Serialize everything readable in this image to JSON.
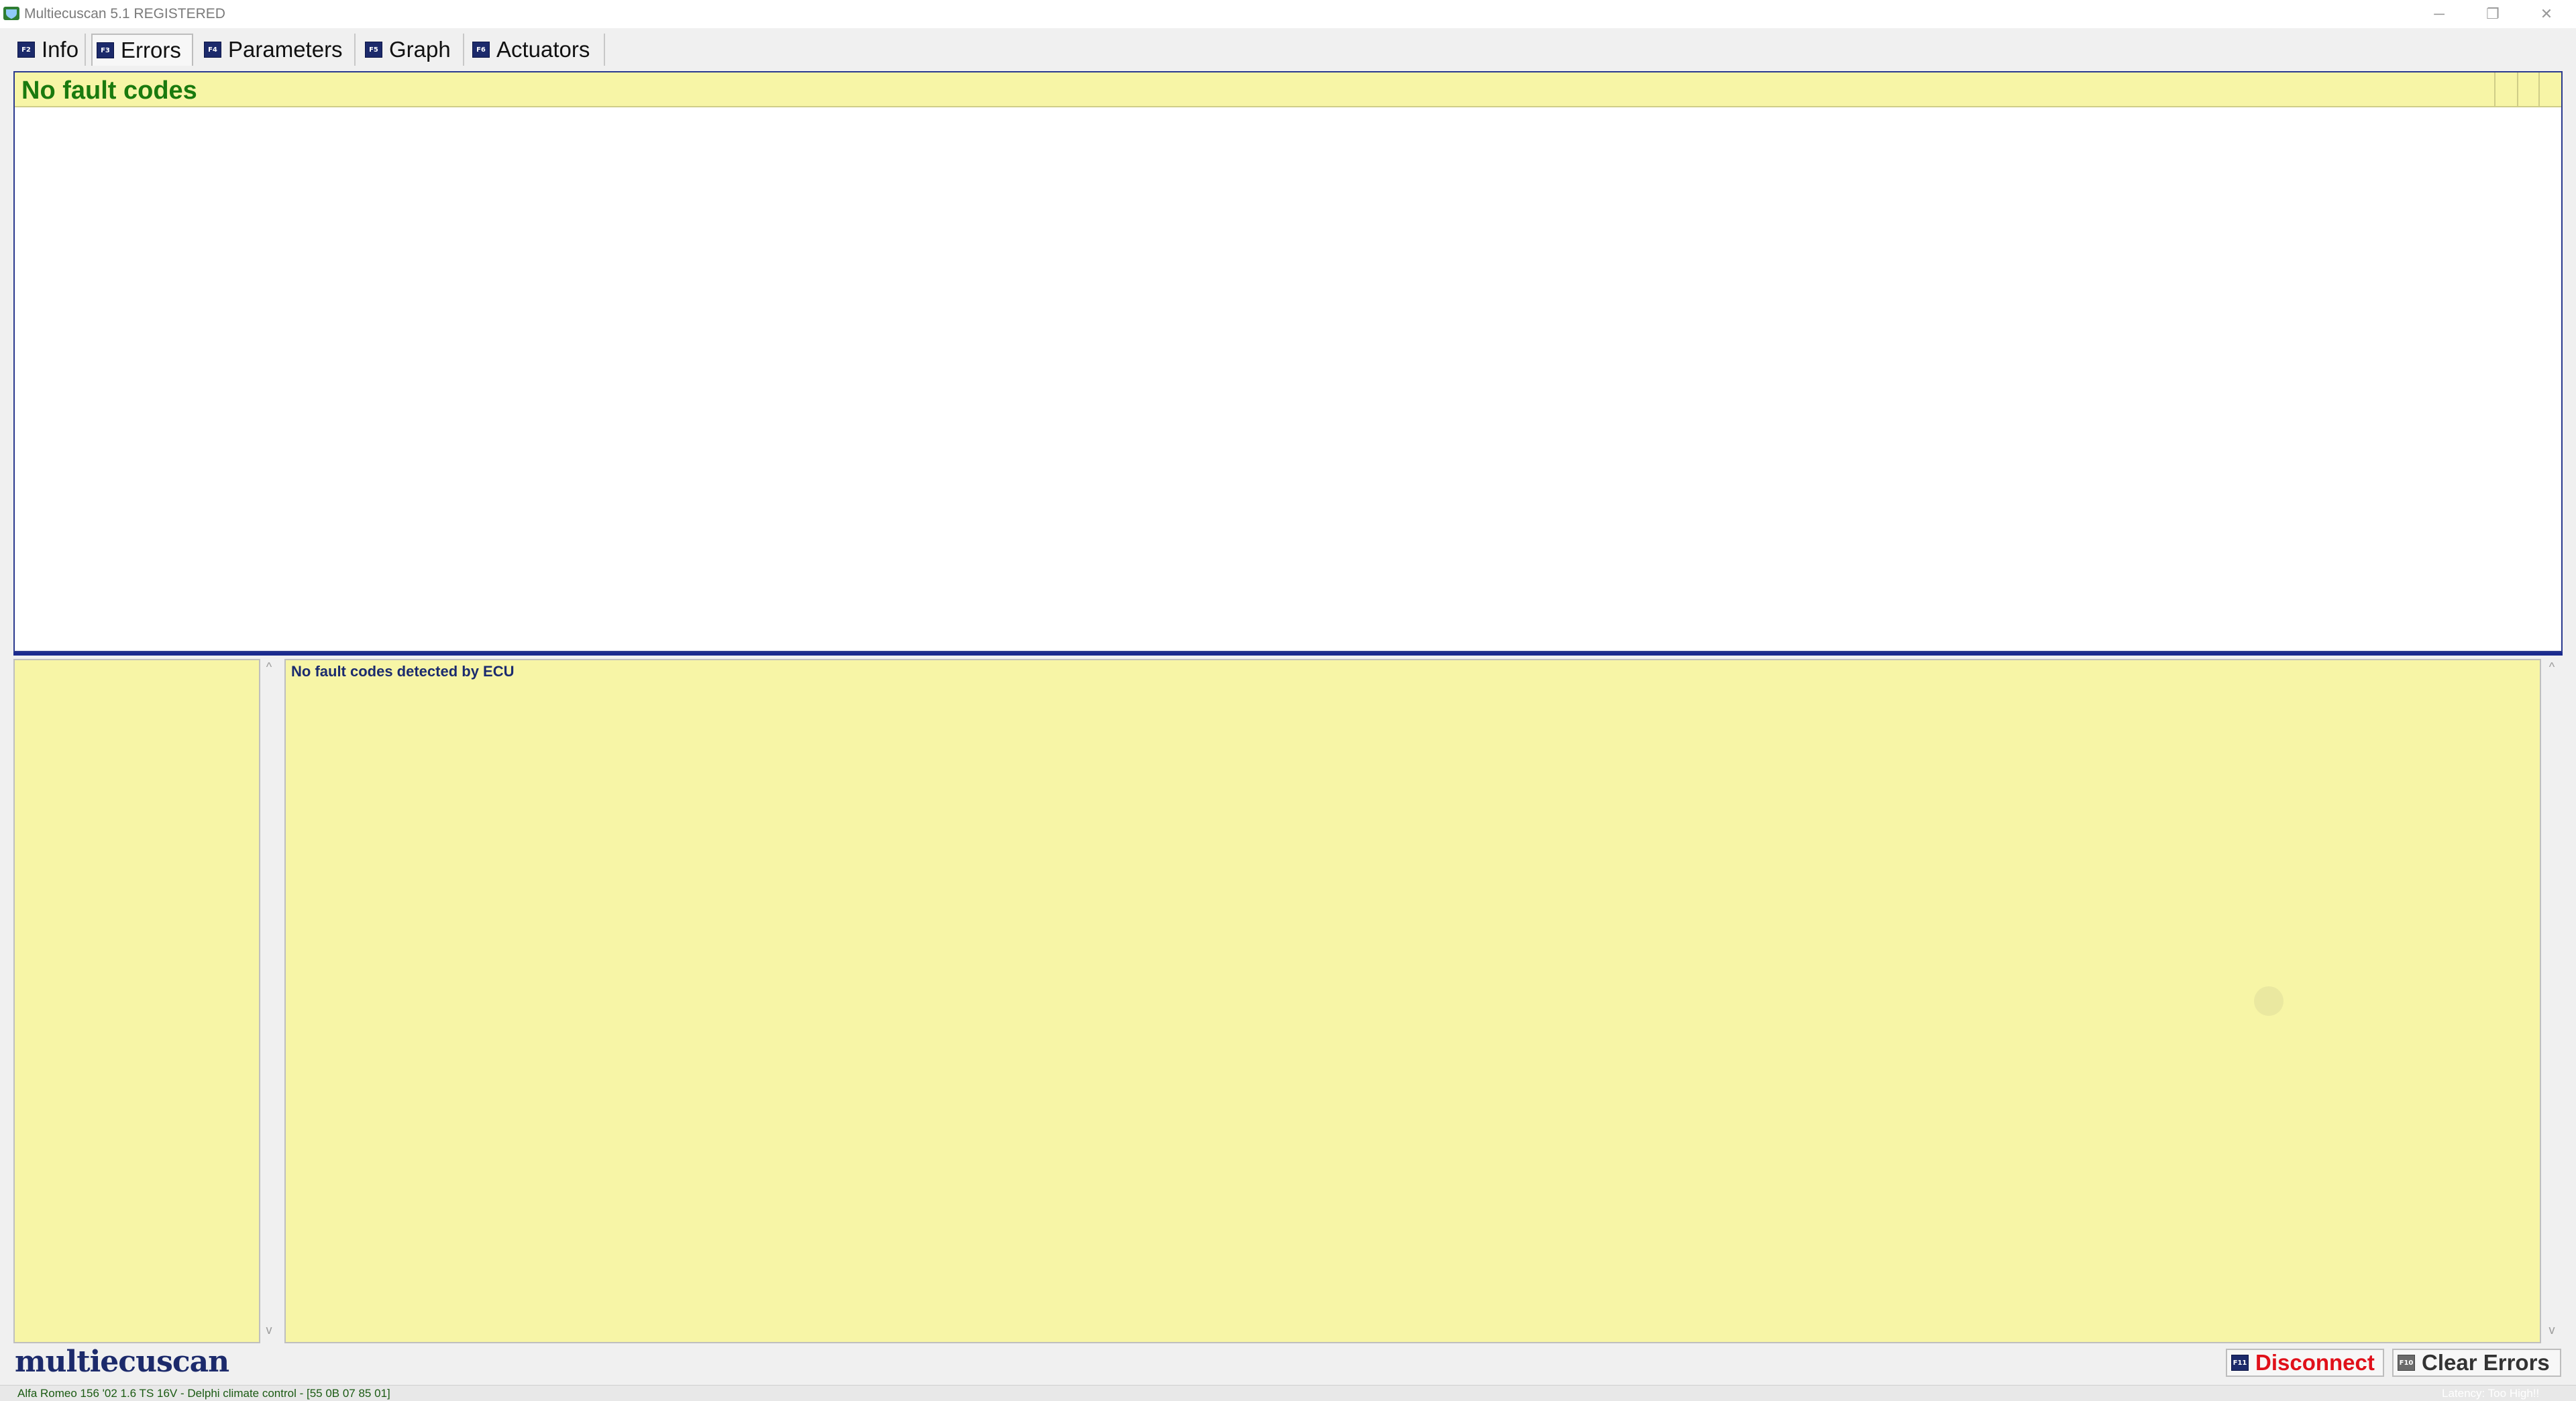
{
  "window": {
    "title": "Multiecuscan 5.1 REGISTERED",
    "minimize_glyph": "─",
    "maximize_glyph": "❐",
    "close_glyph": "✕"
  },
  "tabs": [
    {
      "fkey": "F2",
      "label": "Info",
      "icon": "f2-key-icon"
    },
    {
      "fkey": "F3",
      "label": "Errors",
      "icon": "f3-key-icon",
      "active": true
    },
    {
      "fkey": "F4",
      "label": "Parameters",
      "icon": "f4-key-icon"
    },
    {
      "fkey": "F5",
      "label": "Graph",
      "icon": "f5-key-icon"
    },
    {
      "fkey": "F6",
      "label": "Actuators",
      "icon": "f6-key-icon"
    }
  ],
  "errors_list": {
    "header": "No fault codes"
  },
  "details": {
    "message": "No fault codes detected by ECU"
  },
  "scroll": {
    "up": "^",
    "down": "v"
  },
  "footer": {
    "logo": "multiecuscan",
    "disconnect": {
      "fkey": "F11",
      "label": "Disconnect"
    },
    "clear_errors": {
      "fkey": "F10",
      "label": "Clear Errors"
    }
  },
  "status": {
    "vehicle": "Alfa Romeo 156 '02 1.6 TS 16V - Delphi climate control - [55 0B 07 85 01]",
    "latency": "Latency: Too High!!"
  },
  "colors": {
    "panel_yellow": "#f7f5a6",
    "header_green": "#1a7a0e",
    "disconnect_red": "#e0101a",
    "accent_navy": "#1c2a6b"
  }
}
